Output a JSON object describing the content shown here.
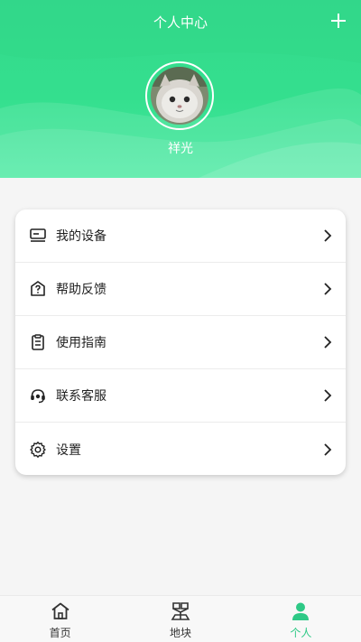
{
  "header": {
    "title": "个人中心",
    "add_icon": "plus-icon",
    "username": "祥光",
    "avatar": "cat-avatar-image"
  },
  "menu": {
    "items": [
      {
        "label": "我的设备",
        "icon": "device-icon"
      },
      {
        "label": "帮助反馈",
        "icon": "help-feedback-icon"
      },
      {
        "label": "使用指南",
        "icon": "guide-icon"
      },
      {
        "label": "联系客服",
        "icon": "customer-service-icon"
      },
      {
        "label": "设置",
        "icon": "gear-icon"
      }
    ],
    "chevron_icon": "chevron-right-icon"
  },
  "tabbar": {
    "tabs": [
      {
        "label": "首页",
        "icon": "home-icon",
        "active": false
      },
      {
        "label": "地块",
        "icon": "field-plot-icon",
        "active": false
      },
      {
        "label": "个人",
        "icon": "person-icon",
        "active": true
      }
    ]
  },
  "colors": {
    "header_green": "#34df8e",
    "accent_green": "#2ec986",
    "background": "#f5f5f5",
    "card": "#ffffff"
  }
}
